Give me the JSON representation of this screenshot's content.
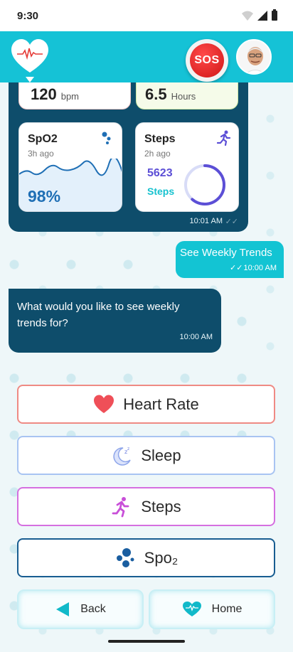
{
  "status_bar": {
    "time": "9:30"
  },
  "header": {
    "sos_label": "SOS",
    "colors": {
      "header_bg": "#15c2d6",
      "sos_red": "#d01616"
    }
  },
  "chat": {
    "card_message": {
      "partial_cards": {
        "heart": {
          "value": "120",
          "unit": "bpm"
        },
        "sleep": {
          "value": "6.5",
          "unit": "Hours"
        }
      },
      "spo2_card": {
        "title": "SpO2",
        "ago": "3h ago",
        "value": "98%",
        "icon": "bubbles-icon"
      },
      "steps_card": {
        "title": "Steps",
        "ago": "2h ago",
        "count": "5623",
        "label": "Steps",
        "icon": "running-icon"
      },
      "time": "10:01 AM"
    },
    "sent_message": {
      "text": "See Weekly Trends",
      "time": "10:00 AM"
    },
    "received_message": {
      "text": "What would you like to see weekly trends for?",
      "time": "10:00 AM"
    }
  },
  "options": [
    {
      "label": "Heart Rate",
      "icon": "heart-icon"
    },
    {
      "label": "Sleep",
      "icon": "moon-icon"
    },
    {
      "label": "Steps",
      "icon": "running-icon"
    },
    {
      "label": "Spo₂",
      "icon": "bubbles-icon"
    }
  ],
  "bottom_nav": {
    "back_label": "Back",
    "home_label": "Home"
  }
}
